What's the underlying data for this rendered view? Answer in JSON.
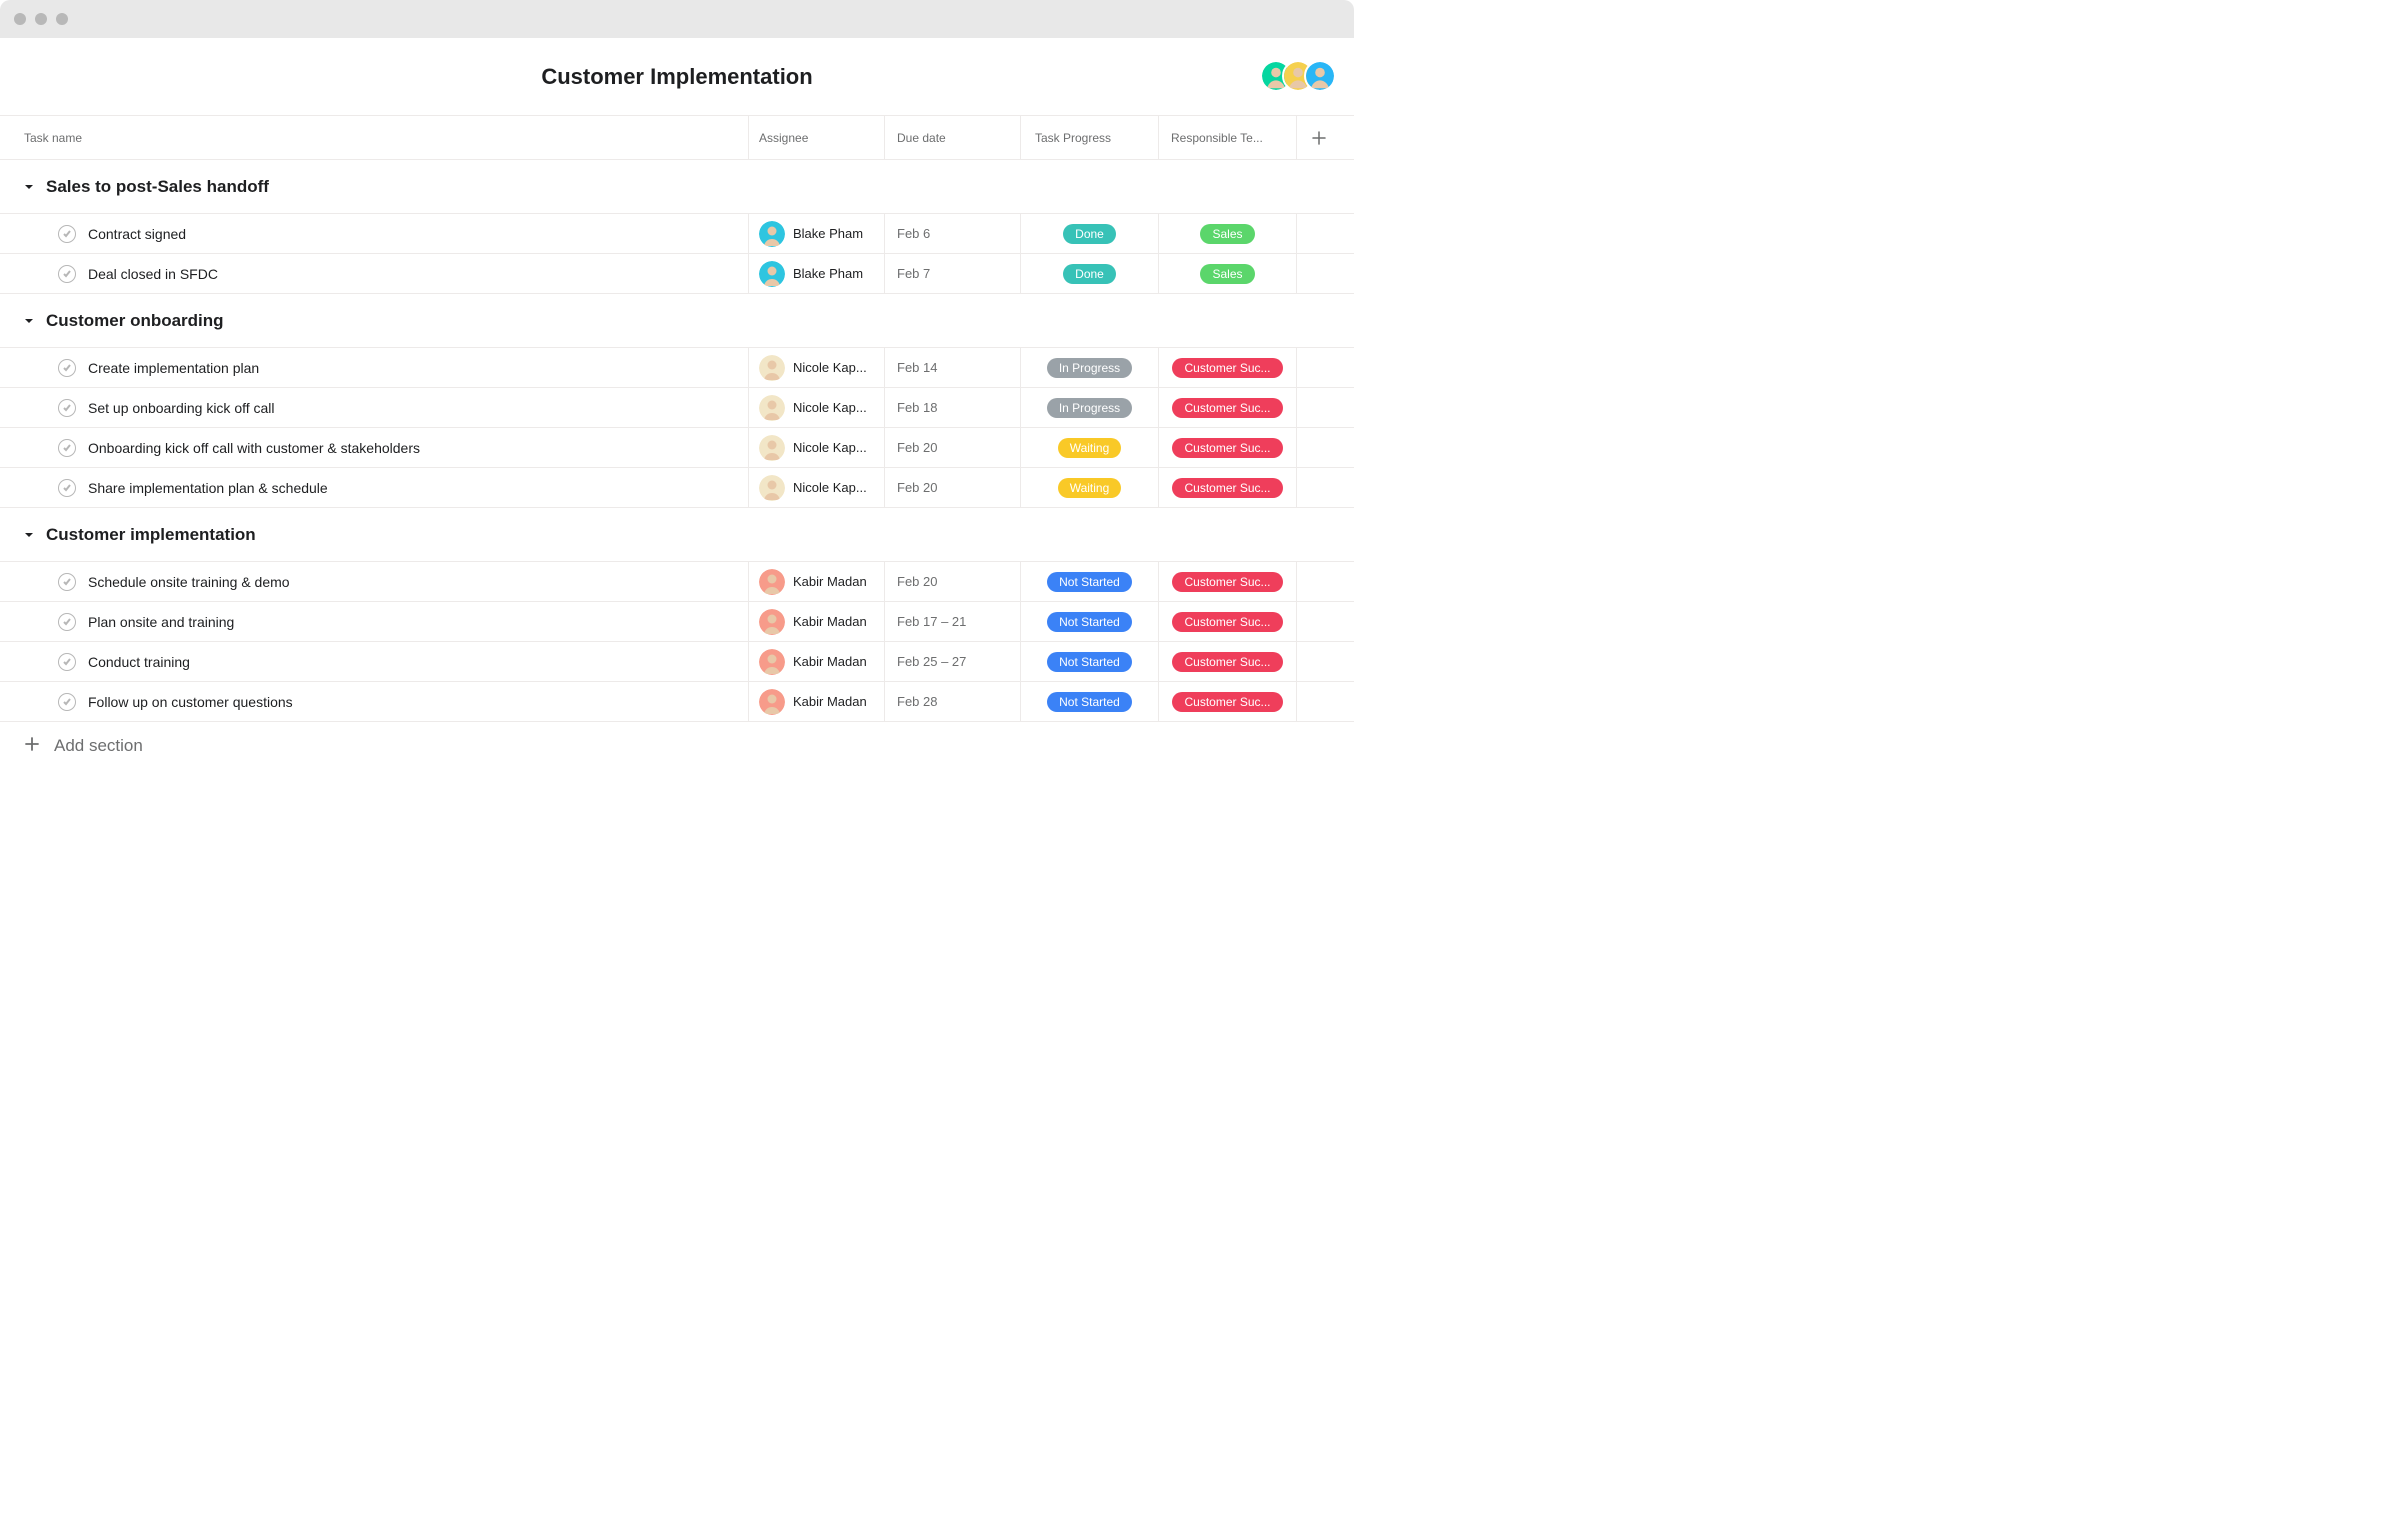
{
  "header": {
    "title": "Customer Implementation",
    "avatar_colors": [
      "#06d6a0",
      "#f5d04e",
      "#29b6f6"
    ]
  },
  "columns": {
    "task": "Task name",
    "assignee": "Assignee",
    "due": "Due date",
    "progress": "Task Progress",
    "team": "Responsible Te..."
  },
  "progress_colors": {
    "Done": "#37c2b7",
    "In Progress": "#9aa2a8",
    "Waiting": "#f9c927",
    "Not Started": "#3b82f6"
  },
  "team_colors": {
    "Sales": "#5bd66b",
    "Customer Suc...": "#ef3e5b"
  },
  "assignee_colors": {
    "Blake Pham": "#2ec5e0",
    "Nicole Kap...": "#f2e6c7",
    "Kabir Madan": "#f79b8a"
  },
  "sections": [
    {
      "name": "Sales to post-Sales handoff",
      "tasks": [
        {
          "title": "Contract signed",
          "assignee": "Blake Pham",
          "due": "Feb 6",
          "progress": "Done",
          "team": "Sales"
        },
        {
          "title": "Deal closed in SFDC",
          "assignee": "Blake Pham",
          "due": "Feb 7",
          "progress": "Done",
          "team": "Sales"
        }
      ]
    },
    {
      "name": "Customer onboarding",
      "tasks": [
        {
          "title": "Create implementation plan",
          "assignee": "Nicole Kap...",
          "due": "Feb 14",
          "progress": "In Progress",
          "team": "Customer Suc..."
        },
        {
          "title": "Set up onboarding kick off call",
          "assignee": "Nicole Kap...",
          "due": "Feb 18",
          "progress": "In Progress",
          "team": "Customer Suc..."
        },
        {
          "title": "Onboarding kick off call with customer & stakeholders",
          "assignee": "Nicole Kap...",
          "due": "Feb 20",
          "progress": "Waiting",
          "team": "Customer Suc..."
        },
        {
          "title": "Share implementation plan & schedule",
          "assignee": "Nicole Kap...",
          "due": "Feb 20",
          "progress": "Waiting",
          "team": "Customer Suc..."
        }
      ]
    },
    {
      "name": "Customer implementation",
      "tasks": [
        {
          "title": "Schedule onsite training & demo",
          "assignee": "Kabir Madan",
          "due": "Feb 20",
          "progress": "Not Started",
          "team": "Customer Suc..."
        },
        {
          "title": "Plan onsite and training",
          "assignee": "Kabir Madan",
          "due": "Feb 17 – 21",
          "progress": "Not Started",
          "team": "Customer Suc..."
        },
        {
          "title": "Conduct training",
          "assignee": "Kabir Madan",
          "due": "Feb 25 – 27",
          "progress": "Not Started",
          "team": "Customer Suc..."
        },
        {
          "title": "Follow up on customer questions",
          "assignee": "Kabir Madan",
          "due": "Feb 28",
          "progress": "Not Started",
          "team": "Customer Suc..."
        }
      ]
    }
  ],
  "footer": {
    "add_section": "Add section"
  }
}
